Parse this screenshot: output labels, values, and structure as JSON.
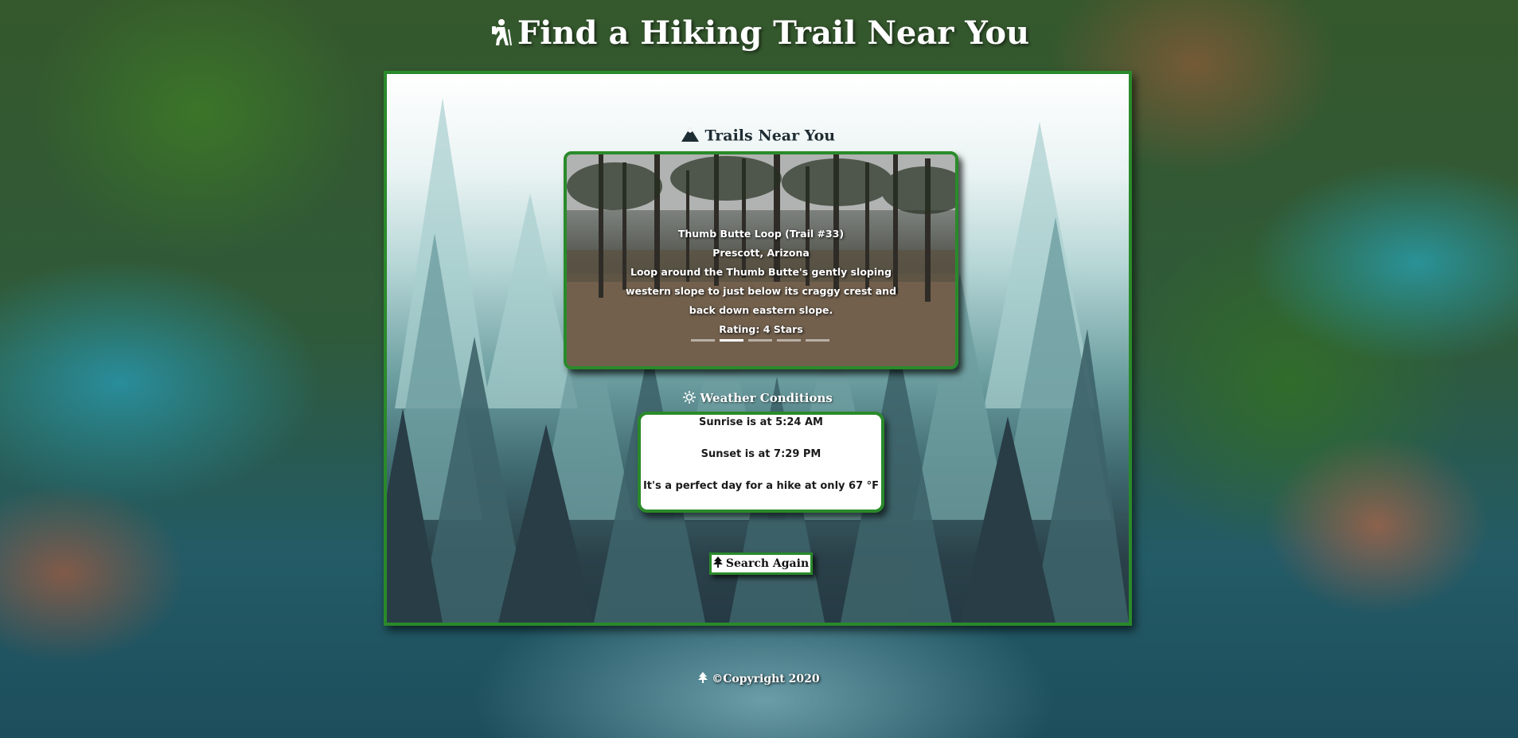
{
  "header": {
    "title": "Find a Hiking Trail Near You",
    "icon": "hiker-icon"
  },
  "trails": {
    "title": "Trails Near You",
    "icon": "mountain-icon",
    "current_slide": {
      "name": "Thumb Butte Loop (Trail #33)",
      "location": "Prescott, Arizona",
      "description": "Loop around the Thumb Butte's gently sloping western slope to just below its craggy crest and back down eastern slope.",
      "rating": "Rating: 4 Stars"
    },
    "slide_count": 5,
    "active_slide": 2
  },
  "weather": {
    "title": "Weather Conditions",
    "icon": "sun-icon",
    "sunrise": "Sunrise is at 5:24 AM",
    "sunset": "Sunset is at 7:29 PM",
    "summary": "It's a perfect day for a hike at only 67 °F"
  },
  "search_again": {
    "label": "Search Again",
    "icon": "tree-icon"
  },
  "footer": {
    "text": "©Copyright 2020",
    "icon": "tree-icon"
  },
  "colors": {
    "accent": "#2a8a2a",
    "panel_dark": "#253a44"
  }
}
